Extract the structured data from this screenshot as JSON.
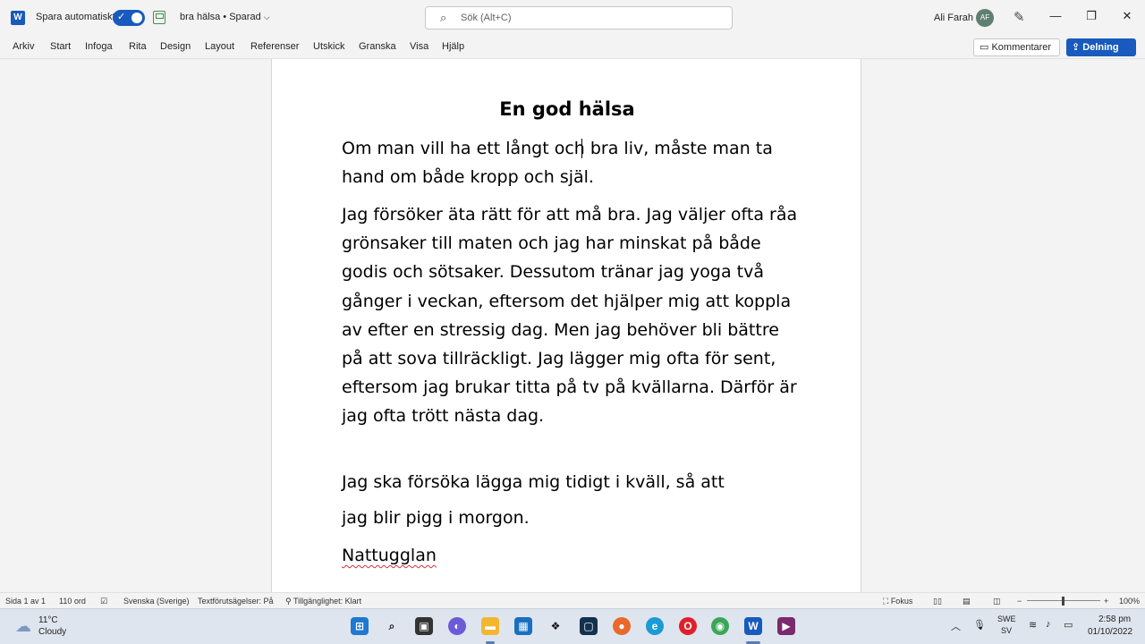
{
  "titlebar": {
    "app_letter": "W",
    "autosave_label": "Spara automatiskt",
    "autosave_check": "✓",
    "doc_title": "bra hälsa • Sparad",
    "search_placeholder": "Sök (Alt+C)",
    "user_name": "Ali Farah",
    "user_initials": "AF",
    "minimize": "—",
    "restore": "❐",
    "close": "✕"
  },
  "menu": {
    "items": [
      "Arkiv",
      "Start",
      "Infoga",
      "Rita",
      "Design",
      "Layout",
      "Referenser",
      "Utskick",
      "Granska",
      "Visa",
      "Hjälp"
    ],
    "comments_label": "Kommentarer",
    "share_label": "Delning"
  },
  "document": {
    "heading": "En god hälsa",
    "p1": "Om man vill ha ett långt och bra liv, måste man ta hand om både kropp och själ.",
    "p2": "Jag försöker äta rätt för att må bra. Jag väljer ofta råa grönsaker till maten och jag har minskat på både godis och sötsaker. Dessutom tränar jag yoga två gånger i veckan, eftersom det hjälper mig att koppla av efter en stressig dag. Men jag behöver bli bättre på att sova tillräckligt. Jag lägger mig ofta för sent, eftersom jag brukar titta på tv på kvällarna. Därför är jag ofta trött nästa dag.",
    "p3": "Jag ska försöka lägga mig tidigt i kväll, så att",
    "p4": "jag blir pigg i morgon.",
    "p5": "Nattugglan"
  },
  "status": {
    "page": "Sida 1 av 1",
    "words": "110 ord",
    "language": "Svenska (Sverige)",
    "predictions": "Textförutsägelser: På",
    "accessibility": "Tillgänglighet: Klart",
    "focus": "Fokus",
    "zoom_minus": "−",
    "zoom_plus": "+",
    "zoom": "100%"
  },
  "taskbar": {
    "temperature": "11°C",
    "weather": "Cloudy",
    "lang_top": "SWE",
    "lang_bottom": "SV",
    "time": "2:58 pm",
    "date": "01/10/2022"
  },
  "colors": {
    "accent": "#185abd",
    "spellcheck": "#d13438"
  }
}
